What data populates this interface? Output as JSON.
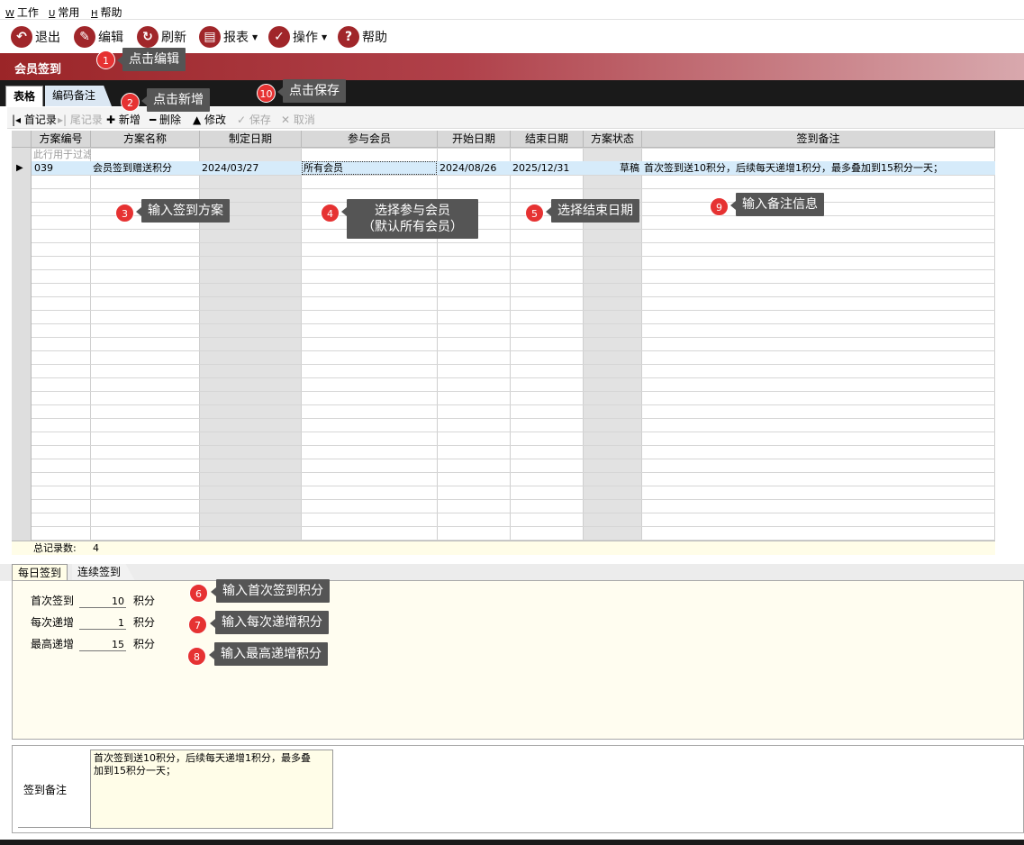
{
  "menu": [
    {
      "key": "W",
      "label": "工作"
    },
    {
      "key": "U",
      "label": "常用"
    },
    {
      "key": "H",
      "label": "帮助"
    }
  ],
  "toolbar": {
    "exit": "退出",
    "edit": "编辑",
    "refresh": "刷新",
    "report": "报表",
    "operate": "操作",
    "help": "帮助"
  },
  "title": "会员签到",
  "tabs": {
    "grid": "表格",
    "code_note": "编码备注"
  },
  "navigator": {
    "first": "首记录",
    "last": "尾记录",
    "add": "新增",
    "delete": "删除",
    "modify": "修改",
    "save": "保存",
    "cancel": "取消"
  },
  "grid": {
    "columns": [
      "方案编号",
      "方案名称",
      "制定日期",
      "参与会员",
      "开始日期",
      "结束日期",
      "方案状态",
      "签到备注"
    ],
    "filter_hint": "此行用于过滤",
    "row": {
      "code": "039",
      "name": "会员签到赠送积分",
      "created": "2024/03/27",
      "members": "所有会员",
      "start": "2024/08/26",
      "end": "2025/12/31",
      "status": "草稿",
      "note": "首次签到送10积分，后续每天递增1积分，最多叠加到15积分一天；"
    },
    "footer_label": "总记录数:",
    "footer_count": "4"
  },
  "lower_tabs": {
    "daily": "每日签到",
    "continuous": "连续签到"
  },
  "fields": [
    {
      "label": "首次签到",
      "value": "10",
      "unit": "积分"
    },
    {
      "label": "每次递增",
      "value": "1",
      "unit": "积分"
    },
    {
      "label": "最高递增",
      "value": "15",
      "unit": "积分"
    }
  ],
  "memo": {
    "label": "签到备注",
    "text": "首次签到送10积分，后续每天递增1积分，最多叠\n加到15积分一天；"
  },
  "callouts": [
    {
      "num": "1",
      "text": "点击编辑"
    },
    {
      "num": "2",
      "text": "点击新增"
    },
    {
      "num": "3",
      "text": "输入签到方案"
    },
    {
      "num": "4",
      "text": "选择参与会员\n（默认所有会员）"
    },
    {
      "num": "5",
      "text": "选择结束日期"
    },
    {
      "num": "6",
      "text": "输入首次签到积分"
    },
    {
      "num": "7",
      "text": "输入每次递增积分"
    },
    {
      "num": "8",
      "text": "输入最高递增积分"
    },
    {
      "num": "9",
      "text": "输入备注信息"
    },
    {
      "num": "10",
      "text": "点击保存"
    }
  ],
  "colors": {
    "brand": "#9b2528",
    "callout_badge": "#e63232",
    "callout_bg": "#555555"
  }
}
